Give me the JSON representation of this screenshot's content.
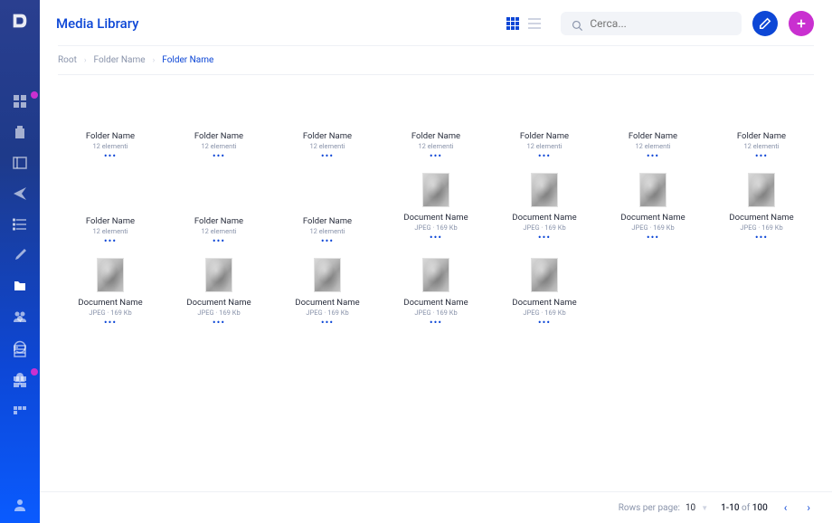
{
  "page_title": "Media Library",
  "search": {
    "placeholder": "Cerca..."
  },
  "breadcrumb": [
    {
      "label": "Root",
      "current": false
    },
    {
      "label": "Folder Name",
      "current": false
    },
    {
      "label": "Folder Name",
      "current": true
    }
  ],
  "folder_label": "Folder Name",
  "folder_meta": "12 elementi",
  "document_label": "Document Name",
  "document_meta": "JPEG · 169 Kb",
  "pagination": {
    "rows_label": "Rows per page:",
    "rows_value": "10",
    "range_start": "1-10",
    "range_of": "of",
    "range_total": "100"
  },
  "colors": {
    "accent": "#0d47d6",
    "secondary": "#c930d0"
  }
}
